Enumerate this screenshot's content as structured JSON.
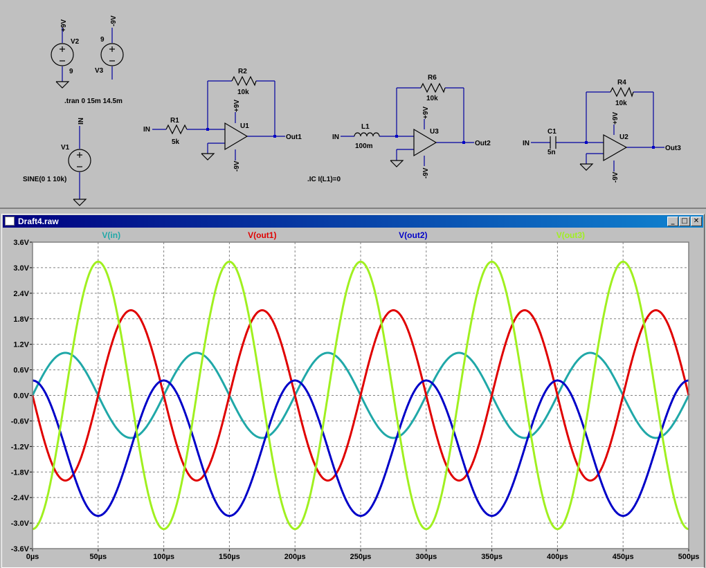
{
  "schematic": {
    "labels": {
      "v2_node": "+9V",
      "v2_name": "V2",
      "v2_value": "9",
      "v3_node": "-9V",
      "v3_name": "V3",
      "v3_value": "9",
      "tran": ".tran 0 15m 14.5m",
      "v1_node": "IN",
      "v1_name": "V1",
      "v1_value": "SINE(0 1 10k)",
      "r1_in": "IN",
      "r1_name": "R1",
      "r1_value": "5k",
      "r2_name": "R2",
      "r2_value": "10k",
      "u1_vp": "+9V",
      "u1_name": "U1",
      "u1_vn": "-9V",
      "u1_out": "Out1",
      "l1_in": "IN",
      "l1_name": "L1",
      "l1_value": "100m",
      "r6_name": "R6",
      "r6_value": "10k",
      "u3_vp": "+9V",
      "u3_name": "U3",
      "u3_vn": "-9V",
      "u3_out": "Out2",
      "ic": ".IC I(L1)=0",
      "c1_in": "IN",
      "c1_name": "C1",
      "c1_value": "5n",
      "r4_name": "R4",
      "r4_value": "10k",
      "u2_vp": "+9V",
      "u2_name": "U2",
      "u2_vn": "-9V",
      "u2_out": "Out3"
    }
  },
  "plot_window": {
    "title": "Draft4.raw",
    "buttons": {
      "minimize": "_",
      "maximize": "□",
      "close": "✕"
    }
  },
  "chart_data": {
    "type": "line",
    "xlabel": "",
    "ylabel": "",
    "xlim": [
      0,
      500
    ],
    "ylim": [
      -3.6,
      3.6
    ],
    "grid": true,
    "x_ticks": [
      "0µs",
      "50µs",
      "100µs",
      "150µs",
      "200µs",
      "250µs",
      "300µs",
      "350µs",
      "400µs",
      "450µs",
      "500µs"
    ],
    "y_ticks": [
      "3.6V",
      "3.0V",
      "2.4V",
      "1.8V",
      "1.2V",
      "0.6V",
      "0.0V",
      "-0.6V",
      "-1.2V",
      "-1.8V",
      "-2.4V",
      "-3.0V",
      "-3.6V"
    ],
    "x_tick_values": [
      0,
      50,
      100,
      150,
      200,
      250,
      300,
      350,
      400,
      450,
      500
    ],
    "y_tick_values": [
      3.6,
      3.0,
      2.4,
      1.8,
      1.2,
      0.6,
      0.0,
      -0.6,
      -1.2,
      -1.8,
      -2.4,
      -3.0,
      -3.6
    ],
    "frequency_khz": 10,
    "series": [
      {
        "name": "V(in)",
        "color": "#20a8a8",
        "amplitude": 1.0,
        "phase_deg": 0,
        "offset": 0
      },
      {
        "name": "V(out1)",
        "color": "#e00000",
        "amplitude": 2.0,
        "phase_deg": 180,
        "offset": 0
      },
      {
        "name": "V(out2)",
        "color": "#0000c8",
        "amplitude": 1.59,
        "phase_deg": 90,
        "offset": -1.24
      },
      {
        "name": "V(out3)",
        "color": "#a0f020",
        "amplitude": 3.14,
        "phase_deg": -90,
        "offset": 0
      }
    ]
  }
}
